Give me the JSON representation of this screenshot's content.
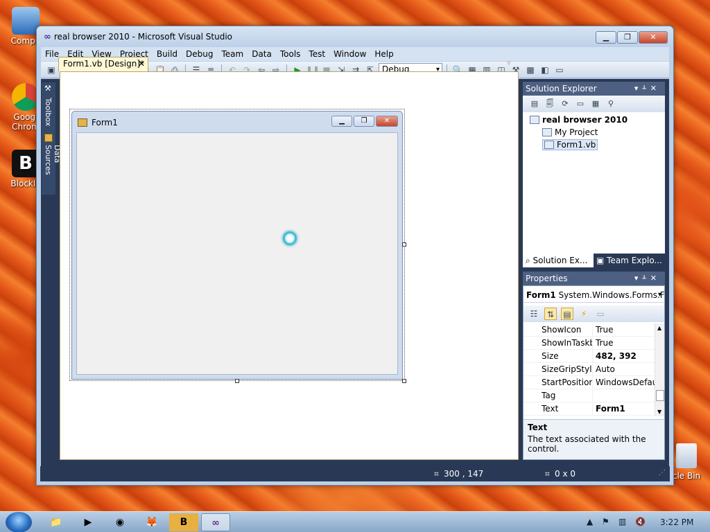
{
  "desktop": {
    "icons": [
      {
        "label": "Compu"
      },
      {
        "label": "Googl Chrom"
      },
      {
        "label": "Blockla"
      }
    ],
    "recycle_label": "cle Bin"
  },
  "window": {
    "title": "real browser 2010 - Microsoft Visual Studio",
    "menu": [
      "File",
      "Edit",
      "View",
      "Project",
      "Build",
      "Debug",
      "Team",
      "Data",
      "Tools",
      "Test",
      "Window",
      "Help"
    ],
    "config_value": "Debug"
  },
  "sidetabs": {
    "toolbox": "Toolbox",
    "data_sources": "Data Sources"
  },
  "document_tab": {
    "label": "Form1.vb [Design]*"
  },
  "form": {
    "title": "Form1"
  },
  "solution_explorer": {
    "header": "Solution Explorer",
    "tree": {
      "solution": "real browser 2010",
      "my_project": "My Project",
      "file": "Form1.vb"
    },
    "tabs": [
      "Solution Ex...",
      "Team Explo..."
    ]
  },
  "properties": {
    "header": "Properties",
    "object": "Form1",
    "object_type": "System.Windows.Forms.Fo",
    "rows": [
      {
        "name": "ShowIcon",
        "value": "True"
      },
      {
        "name": "ShowInTaskba",
        "value": "True"
      },
      {
        "name": "Size",
        "value": "482, 392"
      },
      {
        "name": "SizeGripStyle",
        "value": "Auto"
      },
      {
        "name": "StartPosition",
        "value": "WindowsDefaul"
      },
      {
        "name": "Tag",
        "value": ""
      },
      {
        "name": "Text",
        "value": "Form1"
      }
    ],
    "description_title": "Text",
    "description_text": "The text associated with the control."
  },
  "status": {
    "position": "300 , 147",
    "size": "0 x 0"
  },
  "taskbar": {
    "clock": "3:22 PM"
  }
}
